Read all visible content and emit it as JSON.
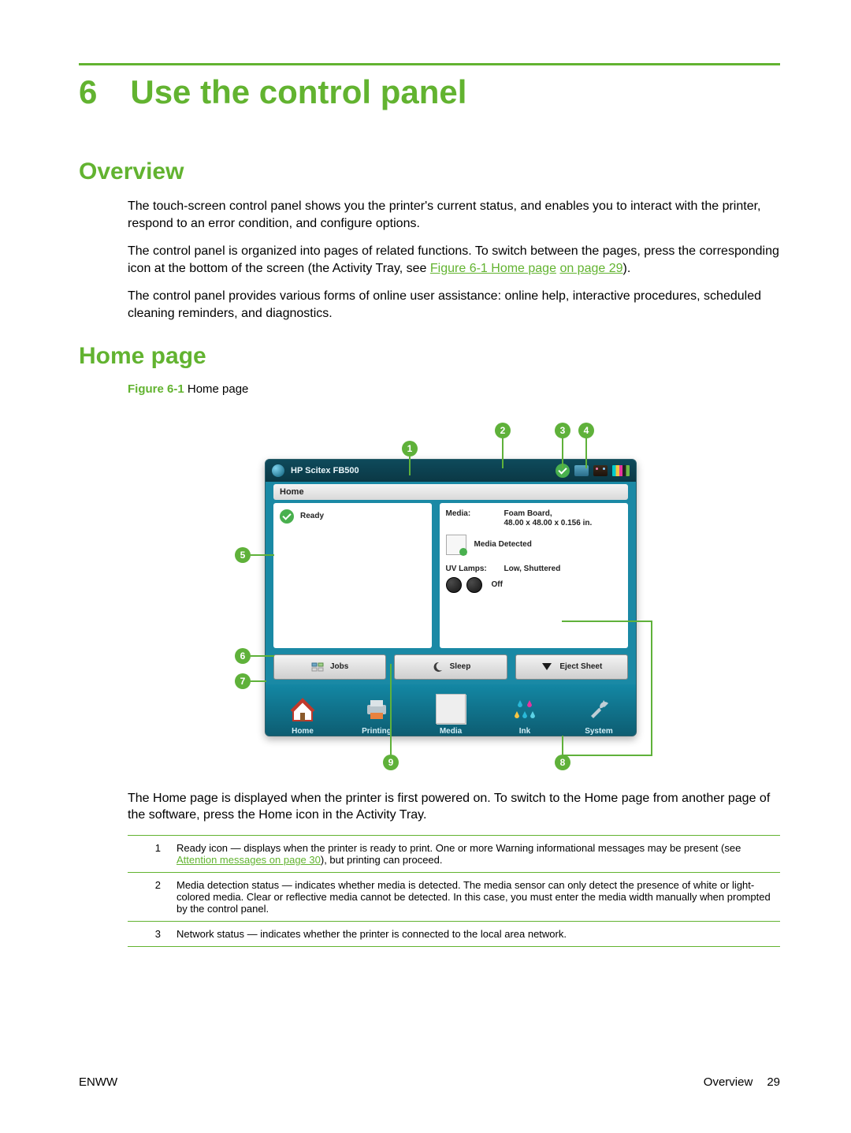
{
  "chapter_number": "6",
  "chapter_title": "Use the control panel",
  "section_overview": {
    "heading": "Overview",
    "p1": "The touch-screen control panel shows you the printer's current status, and enables you to interact with the printer, respond to an error condition, and configure options.",
    "p2_a": "The control panel is organized into pages of related functions. To switch between the pages, press the corresponding icon at the bottom of the screen (the Activity Tray, see ",
    "p2_link1": "Figure 6-1 Home page",
    "p2_link2": "on page 29",
    "p2_b": ").",
    "p3": "The control panel provides various forms of online user assistance: online help, interactive procedures, scheduled cleaning reminders, and diagnostics."
  },
  "section_homepage": {
    "heading": "Home page",
    "figure_label": "Figure 6-1",
    "figure_text": "  Home page",
    "after_figure": "The Home page is displayed when the printer is first powered on. To switch to the Home page from another page of the software, press the Home icon in the Activity Tray."
  },
  "panel": {
    "title": "HP Scitex FB500",
    "home_label": "Home",
    "ready": "Ready",
    "media_label": "Media:",
    "media_value_line1": "Foam Board,",
    "media_value_line2": "48.00 x 48.00 x 0.156 in.",
    "media_detected": "Media Detected",
    "uv_label": "UV Lamps:",
    "uv_value": "Low, Shuttered",
    "uv_off": "Off",
    "btn_jobs": "Jobs",
    "btn_sleep": "Sleep",
    "btn_eject": "Eject Sheet",
    "tray": {
      "home": "Home",
      "printing": "Printing",
      "media": "Media",
      "ink": "Ink",
      "system": "System"
    }
  },
  "callouts": {
    "c1": "1",
    "c2": "2",
    "c3": "3",
    "c4": "4",
    "c5": "5",
    "c6": "6",
    "c7": "7",
    "c8": "8",
    "c9": "9"
  },
  "legend": [
    {
      "idx": "1",
      "text_a": "Ready icon — displays when the printer is ready to print. One or more Warning informational messages may be present (see ",
      "link": "Attention messages on page 30",
      "text_b": "), but printing can proceed."
    },
    {
      "idx": "2",
      "text_a": "Media detection status — indicates whether media is detected. The media sensor can only detect the presence of white or light-colored media. Clear or reflective media cannot be detected. In this case, you must enter the media width manually when prompted by the control panel.",
      "link": "",
      "text_b": ""
    },
    {
      "idx": "3",
      "text_a": "Network status — indicates whether the printer is connected to the local area network.",
      "link": "",
      "text_b": ""
    }
  ],
  "footer": {
    "left": "ENWW",
    "right_label": "Overview",
    "page": "29"
  }
}
